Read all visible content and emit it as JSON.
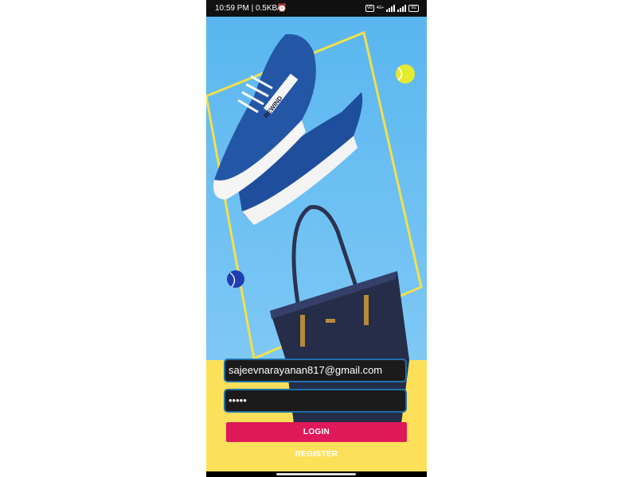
{
  "status_bar": {
    "time": "10:59 PM | 0.5KB/s",
    "alarm_icon": "alarm-clock-icon",
    "network_badge": "Vo",
    "data_badge": "4G+",
    "battery": "92"
  },
  "hero": {
    "shoe_brand_text": "REWIND"
  },
  "form": {
    "email_value": "sajeevnarayanan817@gmail.com",
    "password_value": "•••••",
    "login_label": "LOGIN",
    "register_label": "REGISTER"
  },
  "colors": {
    "sky_background": "#5ab6ef",
    "floor_background": "#fde05a",
    "login_button": "#e0195a",
    "field_border": "#1e6fa8"
  }
}
